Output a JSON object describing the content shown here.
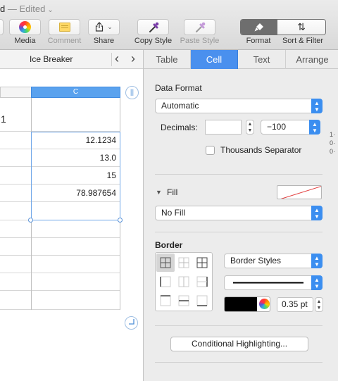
{
  "window": {
    "title_prefix": "d",
    "title_suffix": " — Edited",
    "title_chevron": "⌄"
  },
  "toolbar": {
    "media_label": "Media",
    "comment_label": "Comment",
    "share_label": "Share",
    "copy_style_label": "Copy Style",
    "paste_style_label": "Paste Style",
    "format_label": "Format",
    "sort_filter_label": "Sort & Filter",
    "share_chevron": "⌄",
    "sort_glyph": "⇅"
  },
  "sheet": {
    "name": "Ice Breaker",
    "prev_arrow": "‹",
    "next_arrow": "›",
    "column_header": "C",
    "row_header_value": "1",
    "cells": [
      "12.1234",
      "13.0",
      "15",
      "78.987654"
    ],
    "col_button": "||"
  },
  "inspector": {
    "tabs": [
      "Table",
      "Cell",
      "Text",
      "Arrange"
    ],
    "active_tab": "Cell",
    "data_format": {
      "title": "Data Format",
      "value": "Automatic",
      "decimals_label": "Decimals:",
      "decimals_value": "",
      "negative_value": "−100",
      "thousands_label": "Thousands Separator",
      "thousands_checked": false
    },
    "fill": {
      "title": "Fill",
      "value": "No Fill"
    },
    "border": {
      "title": "Border",
      "styles_value": "Border Styles",
      "width_value": "0.35 pt",
      "color": "#000000"
    },
    "conditional_button": "Conditional Highlighting..."
  },
  "colors": {
    "accent": "#4a90ee",
    "selection_header": "#5aa2ee",
    "format_button": "#6e6e6e"
  }
}
